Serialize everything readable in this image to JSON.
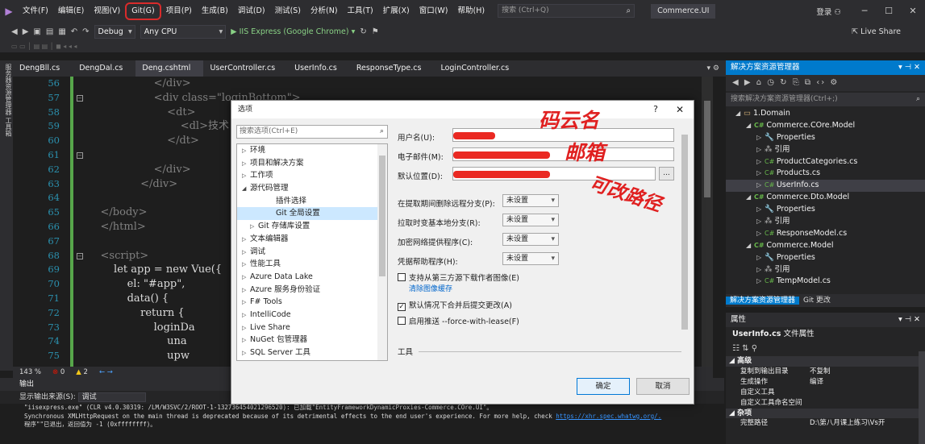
{
  "menu": {
    "items": [
      "文件(F)",
      "编辑(E)",
      "视图(V)",
      "Git(G)",
      "项目(P)",
      "生成(B)",
      "调试(D)",
      "测试(S)",
      "分析(N)",
      "工具(T)",
      "扩展(X)",
      "窗口(W)",
      "帮助(H)"
    ],
    "search_placeholder": "搜索 (Ctrl+Q)",
    "solution_name": "Commerce.UI",
    "login": "登录",
    "login_icon": "person-icon"
  },
  "toolbar": {
    "config": "Debug",
    "platform": "Any CPU",
    "run_target": "▶ IIS Express (Google Chrome) ▾",
    "live_share": "Live Share"
  },
  "left_strip": "服务器资源管理器  工具箱",
  "tabs": [
    "DengBll.cs",
    "DengDal.cs",
    "Deng.cshtml",
    "UserController.cs",
    "UserInfo.cs",
    "ResponseType.cs",
    "LoginController.cs"
  ],
  "editor": {
    "line_numbers": [
      "56",
      "57",
      "58",
      "59",
      "60",
      "61",
      "62",
      "63",
      "64",
      "65",
      "66",
      "67",
      "68",
      "69",
      "70",
      "71",
      "72",
      "73",
      "74",
      "75"
    ],
    "lines": [
      "                    </div>",
      "                    <div class=\"loginBottom\">",
      "                        <dt>",
      "                            <dl>技术",
      "                        </dt>",
      "",
      "                    </div>",
      "                </div>",
      "",
      "    </body>",
      "    </html>",
      "",
      "    <script>",
      "        let app = new Vue({",
      "            el: \"#app\",",
      "            data() {",
      "                return {",
      "                    loginDa",
      "                        una",
      "                        upw"
    ],
    "zoom": "143 %",
    "errors": "0",
    "warnings": "2"
  },
  "output": {
    "title": "输出",
    "source_label": "显示输出来源(S):",
    "source_value": "调试",
    "lines": [
      "\"iisexpress.exe\" (CLR v4.0.30319: /LM/W3SVC/2/ROOT-1-132736454021296520): 已加载\"EntityFrameworkDynamicProxies-Commerce.COre.UI\"。",
      "Synchronous XMLHttpRequest on the main thread is deprecated because of its detrimental effects to the end user's experience. For more help, check ",
      "程序\"\"已退出，返回值为 -1 (0xffffffff)。"
    ],
    "link": "https://xhr.spec.whatwg.org/."
  },
  "solution_explorer": {
    "title": "解决方案资源管理器",
    "search_placeholder": "搜索解决方案资源管理器(Ctrl+;)",
    "tree": [
      {
        "label": "1.Domain",
        "kind": "folder",
        "indent": 0,
        "exp": "◢"
      },
      {
        "label": "Commerce.COre.Model",
        "kind": "proj",
        "indent": 1,
        "exp": "◢"
      },
      {
        "label": "Properties",
        "kind": "wrench",
        "indent": 2,
        "exp": "▷"
      },
      {
        "label": "引用",
        "kind": "ref",
        "indent": 2,
        "exp": "▷"
      },
      {
        "label": "ProductCategories.cs",
        "kind": "cs",
        "indent": 2,
        "exp": "▷"
      },
      {
        "label": "Products.cs",
        "kind": "cs",
        "indent": 2,
        "exp": "▷"
      },
      {
        "label": "UserInfo.cs",
        "kind": "cs",
        "indent": 2,
        "exp": "▷",
        "selected": true
      },
      {
        "label": "Commerce.Dto.Model",
        "kind": "proj",
        "indent": 1,
        "exp": "◢"
      },
      {
        "label": "Properties",
        "kind": "wrench",
        "indent": 2,
        "exp": "▷"
      },
      {
        "label": "引用",
        "kind": "ref",
        "indent": 2,
        "exp": "▷"
      },
      {
        "label": "ResponseModel.cs",
        "kind": "cs",
        "indent": 2,
        "exp": "▷"
      },
      {
        "label": "Commerce.Model",
        "kind": "proj",
        "indent": 1,
        "exp": "◢"
      },
      {
        "label": "Properties",
        "kind": "wrench",
        "indent": 2,
        "exp": "▷"
      },
      {
        "label": "引用",
        "kind": "ref",
        "indent": 2,
        "exp": "▷"
      },
      {
        "label": "TempModel.cs",
        "kind": "cs",
        "indent": 2,
        "exp": "▷"
      }
    ],
    "bottom_tabs": [
      "解决方案资源管理器",
      "Git 更改"
    ]
  },
  "properties": {
    "title": "属性",
    "file": "UserInfo.cs",
    "file_suffix": "文件属性",
    "cat1": "高级",
    "rows1": [
      {
        "k": "复制到输出目录",
        "v": "不复制"
      },
      {
        "k": "生成操作",
        "v": "编译"
      },
      {
        "k": "自定义工具",
        "v": ""
      },
      {
        "k": "自定义工具命名空间",
        "v": ""
      }
    ],
    "cat2": "杂项",
    "rows2": [
      {
        "k": "完整路径",
        "v": "D:\\第八月课上练习\\Vs开"
      }
    ]
  },
  "dialog": {
    "title": "选项",
    "help": "?",
    "close": "✕",
    "search_placeholder": "搜索选项(Ctrl+E)",
    "tree": [
      {
        "label": "环境",
        "exp": "▷",
        "level": 0
      },
      {
        "label": "项目和解决方案",
        "exp": "▷",
        "level": 0
      },
      {
        "label": "工作项",
        "exp": "▷",
        "level": 0
      },
      {
        "label": "源代码管理",
        "exp": "◢",
        "level": 0
      },
      {
        "label": "插件选择",
        "exp": "",
        "level": 2
      },
      {
        "label": "Git 全局设置",
        "exp": "",
        "level": 2,
        "selected": true
      },
      {
        "label": "Git 存储库设置",
        "exp": "▷",
        "level": 1
      },
      {
        "label": "文本编辑器",
        "exp": "▷",
        "level": 0
      },
      {
        "label": "调试",
        "exp": "▷",
        "level": 0
      },
      {
        "label": "性能工具",
        "exp": "▷",
        "level": 0
      },
      {
        "label": "Azure Data Lake",
        "exp": "▷",
        "level": 0
      },
      {
        "label": "Azure 服务身份验证",
        "exp": "▷",
        "level": 0
      },
      {
        "label": "F# Tools",
        "exp": "▷",
        "level": 0
      },
      {
        "label": "IntelliCode",
        "exp": "▷",
        "level": 0
      },
      {
        "label": "Live Share",
        "exp": "▷",
        "level": 0
      },
      {
        "label": "NuGet 包管理器",
        "exp": "▷",
        "level": 0
      },
      {
        "label": "SQL Server 工具",
        "exp": "▷",
        "level": 0
      }
    ],
    "username_label": "用户名(U):",
    "email_label": "电子邮件(M):",
    "default_location_label": "默认位置(D):",
    "browse": "...",
    "selects": [
      {
        "label": "在提取期间删除远程分支(P):",
        "value": "未设置"
      },
      {
        "label": "拉取时变基本地分支(R):",
        "value": "未设置"
      },
      {
        "label": "加密网络提供程序(C):",
        "value": "未设置"
      },
      {
        "label": "凭据帮助程序(H):",
        "value": "未设置"
      }
    ],
    "checkbox1": "支持从第三方源下载作者图像(E)",
    "checkbox1_checked": false,
    "clear_cache": "清除图像缓存",
    "checkbox2": "默认情况下合并后提交更改(A)",
    "checkbox2_checked": true,
    "checkbox3": "启用推送 --force-with-lease(F)",
    "checkbox3_checked": false,
    "tools_section": "工具",
    "ok": "确定",
    "cancel": "取消"
  },
  "annotations": {
    "username_note": "码云名",
    "email_note": "邮箱",
    "path_note": "可改路径"
  }
}
